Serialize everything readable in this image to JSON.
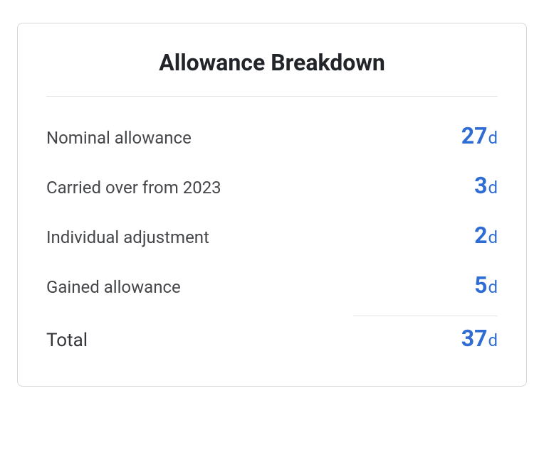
{
  "title": "Allowance Breakdown",
  "unit": "d",
  "rows": [
    {
      "label": "Nominal allowance",
      "value": "27"
    },
    {
      "label": "Carried over from 2023",
      "value": "3"
    },
    {
      "label": "Individual adjustment",
      "value": "2"
    },
    {
      "label": "Gained allowance",
      "value": "5"
    }
  ],
  "total": {
    "label": "Total",
    "value": "37"
  }
}
